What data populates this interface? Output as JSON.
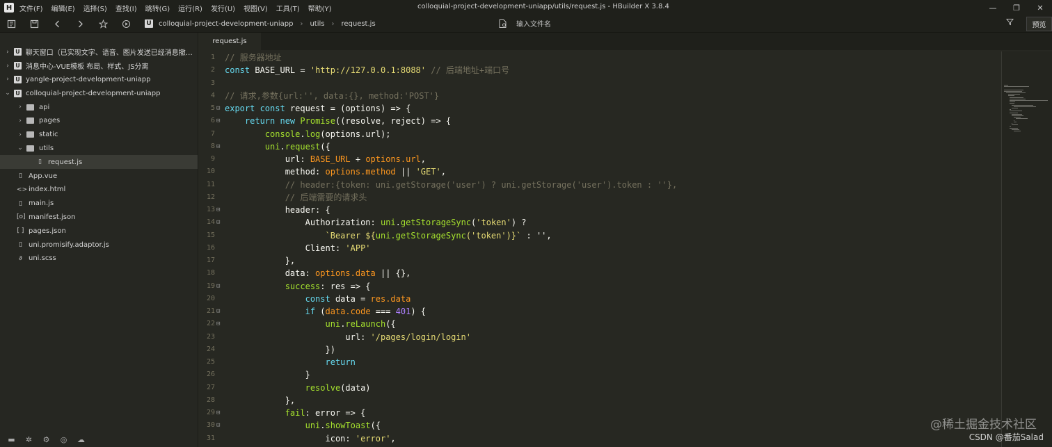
{
  "menubar": {
    "logo_glyph": "H",
    "items": [
      "文件(F)",
      "编辑(E)",
      "选择(S)",
      "查找(I)",
      "跳转(G)",
      "运行(R)",
      "发行(U)",
      "视图(V)",
      "工具(T)",
      "帮助(Y)"
    ],
    "window_title": "colloquial-project-development-uniapp/utils/request.js - HBuilder X 3.8.4",
    "controls": {
      "minimize": "—",
      "restore": "❐",
      "close": "✕"
    }
  },
  "toolbar": {
    "icons": [
      "new-file-icon",
      "save-icon",
      "back-icon",
      "forward-icon",
      "star-icon",
      "run-icon"
    ],
    "crumb_logo": "U",
    "breadcrumbs": [
      "colloquial-project-development-uniapp",
      "utils",
      "request.js"
    ],
    "file_search_placeholder": "输入文件名",
    "preview_label": "预览"
  },
  "sidebar": {
    "tree": [
      {
        "label": "聊天窗口（已实现文字、语音、图片发送已经消息撤回...",
        "type": "project",
        "expanded": false,
        "depth": 0
      },
      {
        "label": "消息中心-VUE模板 布局、样式、JS分离",
        "type": "project",
        "expanded": false,
        "depth": 0
      },
      {
        "label": "yangle-project-development-uniapp",
        "type": "project",
        "expanded": false,
        "depth": 0
      },
      {
        "label": "colloquial-project-development-uniapp",
        "type": "project",
        "expanded": true,
        "depth": 0
      },
      {
        "label": "api",
        "type": "folder",
        "expanded": false,
        "depth": 1
      },
      {
        "label": "pages",
        "type": "folder",
        "expanded": false,
        "depth": 1
      },
      {
        "label": "static",
        "type": "folder",
        "expanded": false,
        "depth": 1
      },
      {
        "label": "utils",
        "type": "folder",
        "expanded": true,
        "depth": 1
      },
      {
        "label": "request.js",
        "type": "file",
        "glyph": "▯",
        "depth": 2,
        "selected": true
      },
      {
        "label": "App.vue",
        "type": "file",
        "glyph": "▯",
        "depth": 1
      },
      {
        "label": "index.html",
        "type": "file",
        "glyph": "<>",
        "depth": 1
      },
      {
        "label": "main.js",
        "type": "file",
        "glyph": "▯",
        "depth": 1
      },
      {
        "label": "manifest.json",
        "type": "file",
        "glyph": "[o]",
        "depth": 1
      },
      {
        "label": "pages.json",
        "type": "file",
        "glyph": "[ ]",
        "depth": 1
      },
      {
        "label": "uni.promisify.adaptor.js",
        "type": "file",
        "glyph": "▯",
        "depth": 1
      },
      {
        "label": "uni.scss",
        "type": "file",
        "glyph": "∂",
        "depth": 1
      }
    ],
    "bottom_icons": [
      "folder-icon",
      "bug-icon",
      "plugin-icon",
      "settings-icon",
      "cloud-icon"
    ]
  },
  "editor": {
    "tab": "request.js",
    "lines": [
      {
        "n": "1",
        "fold": "",
        "tokens": [
          [
            "c",
            "// 服务器地址"
          ]
        ]
      },
      {
        "n": "2",
        "fold": "",
        "tokens": [
          [
            "k",
            "const "
          ],
          [
            "t",
            "BASE_URL = "
          ],
          [
            "s",
            "'http://127.0.0.1:8088'"
          ],
          [
            "c",
            " // 后端地址+端口号"
          ]
        ]
      },
      {
        "n": "3",
        "fold": "",
        "tokens": []
      },
      {
        "n": "4",
        "fold": "",
        "tokens": [
          [
            "c",
            "// 请求,参数{url:'', data:{}, method:'POST'}"
          ]
        ]
      },
      {
        "n": "5",
        "fold": "⊟",
        "tokens": [
          [
            "k",
            "export const "
          ],
          [
            "t",
            "request = (options) => {"
          ]
        ]
      },
      {
        "n": "6",
        "fold": "⊟",
        "tokens": [
          [
            "t",
            "    "
          ],
          [
            "k",
            "return new "
          ],
          [
            "f",
            "Promise"
          ],
          [
            "t",
            "((resolve, reject) => {"
          ]
        ]
      },
      {
        "n": "7",
        "fold": "",
        "tokens": [
          [
            "t",
            "        "
          ],
          [
            "f",
            "console"
          ],
          [
            "t",
            "."
          ],
          [
            "f",
            "log"
          ],
          [
            "t",
            "(options.url);"
          ]
        ]
      },
      {
        "n": "8",
        "fold": "⊟",
        "tokens": [
          [
            "t",
            "        "
          ],
          [
            "f",
            "uni"
          ],
          [
            "t",
            "."
          ],
          [
            "f",
            "request"
          ],
          [
            "t",
            "({"
          ]
        ]
      },
      {
        "n": "9",
        "fold": "",
        "tokens": [
          [
            "t",
            "            url: "
          ],
          [
            "p",
            "BASE_URL"
          ],
          [
            "t",
            " + "
          ],
          [
            "p",
            "options.url"
          ],
          [
            "t",
            ","
          ]
        ]
      },
      {
        "n": "10",
        "fold": "",
        "tokens": [
          [
            "t",
            "            method: "
          ],
          [
            "p",
            "options.method"
          ],
          [
            "t",
            " || "
          ],
          [
            "s",
            "'GET'"
          ],
          [
            "t",
            ","
          ]
        ]
      },
      {
        "n": "11",
        "fold": "",
        "tokens": [
          [
            "t",
            "            "
          ],
          [
            "c",
            "// header:{token: uni.getStorage('user') ? uni.getStorage('user').token : ''},"
          ]
        ]
      },
      {
        "n": "12",
        "fold": "",
        "tokens": [
          [
            "t",
            "            "
          ],
          [
            "c",
            "// 后端需要的请求头"
          ]
        ]
      },
      {
        "n": "13",
        "fold": "⊟",
        "tokens": [
          [
            "t",
            "            header: {"
          ]
        ]
      },
      {
        "n": "14",
        "fold": "⊟",
        "tokens": [
          [
            "t",
            "                Authorization: "
          ],
          [
            "f",
            "uni"
          ],
          [
            "t",
            "."
          ],
          [
            "f",
            "getStorageSync"
          ],
          [
            "t",
            "("
          ],
          [
            "s",
            "'token'"
          ],
          [
            "t",
            ") ?"
          ]
        ]
      },
      {
        "n": "15",
        "fold": "",
        "tokens": [
          [
            "t",
            "                    "
          ],
          [
            "s",
            "`Bearer ${"
          ],
          [
            "f",
            "uni.getStorageSync"
          ],
          [
            "s",
            "('token')}`"
          ],
          [
            "t",
            " : '',"
          ]
        ]
      },
      {
        "n": "16",
        "fold": "",
        "tokens": [
          [
            "t",
            "                Client: "
          ],
          [
            "s",
            "'APP'"
          ]
        ]
      },
      {
        "n": "17",
        "fold": "",
        "tokens": [
          [
            "t",
            "            },"
          ]
        ]
      },
      {
        "n": "18",
        "fold": "",
        "tokens": [
          [
            "t",
            "            data: "
          ],
          [
            "p",
            "options.data"
          ],
          [
            "t",
            " || {},"
          ]
        ]
      },
      {
        "n": "19",
        "fold": "⊟",
        "tokens": [
          [
            "t",
            "            "
          ],
          [
            "f",
            "success"
          ],
          [
            "t",
            ": res => {"
          ]
        ]
      },
      {
        "n": "20",
        "fold": "",
        "tokens": [
          [
            "t",
            "                "
          ],
          [
            "k",
            "const "
          ],
          [
            "t",
            "data = "
          ],
          [
            "p",
            "res.data"
          ]
        ]
      },
      {
        "n": "21",
        "fold": "⊟",
        "tokens": [
          [
            "t",
            "                "
          ],
          [
            "k",
            "if "
          ],
          [
            "t",
            "("
          ],
          [
            "p",
            "data.code"
          ],
          [
            "t",
            " === "
          ],
          [
            "n",
            "401"
          ],
          [
            "t",
            ") {"
          ]
        ]
      },
      {
        "n": "22",
        "fold": "⊟",
        "tokens": [
          [
            "t",
            "                    "
          ],
          [
            "f",
            "uni"
          ],
          [
            "t",
            "."
          ],
          [
            "f",
            "reLaunch"
          ],
          [
            "t",
            "({"
          ]
        ]
      },
      {
        "n": "23",
        "fold": "",
        "tokens": [
          [
            "t",
            "                        url: "
          ],
          [
            "s",
            "'/pages/login/login'"
          ]
        ]
      },
      {
        "n": "24",
        "fold": "",
        "tokens": [
          [
            "t",
            "                    })"
          ]
        ]
      },
      {
        "n": "25",
        "fold": "",
        "tokens": [
          [
            "t",
            "                    "
          ],
          [
            "k",
            "return"
          ]
        ]
      },
      {
        "n": "26",
        "fold": "",
        "tokens": [
          [
            "t",
            "                }"
          ]
        ]
      },
      {
        "n": "27",
        "fold": "",
        "tokens": [
          [
            "t",
            "                "
          ],
          [
            "f",
            "resolve"
          ],
          [
            "t",
            "(data)"
          ]
        ]
      },
      {
        "n": "28",
        "fold": "",
        "tokens": [
          [
            "t",
            "            },"
          ]
        ]
      },
      {
        "n": "29",
        "fold": "⊟",
        "tokens": [
          [
            "t",
            "            "
          ],
          [
            "f",
            "fail"
          ],
          [
            "t",
            ": error => {"
          ]
        ]
      },
      {
        "n": "30",
        "fold": "⊟",
        "tokens": [
          [
            "t",
            "                "
          ],
          [
            "f",
            "uni"
          ],
          [
            "t",
            "."
          ],
          [
            "f",
            "showToast"
          ],
          [
            "t",
            "({"
          ]
        ]
      },
      {
        "n": "31",
        "fold": "",
        "tokens": [
          [
            "t",
            "                    icon: "
          ],
          [
            "s",
            "'error'"
          ],
          [
            "t",
            ","
          ]
        ]
      }
    ]
  },
  "watermark": "@稀土掘金技术社区",
  "watermark2": "CSDN @番茄Salad"
}
